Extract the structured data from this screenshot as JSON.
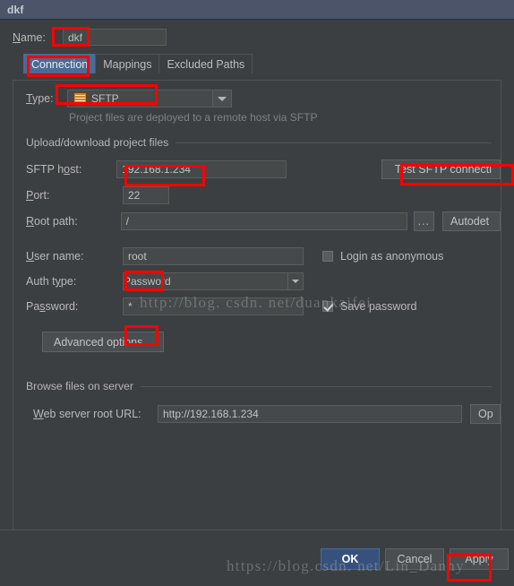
{
  "window": {
    "title": "dkf"
  },
  "name_row": {
    "label": "Name:",
    "value": "dkf"
  },
  "tabs": [
    {
      "label": "Connection",
      "selected": true
    },
    {
      "label": "Mappings",
      "selected": false
    },
    {
      "label": "Excluded Paths",
      "selected": false
    }
  ],
  "type_row": {
    "label": "Type:",
    "value": "SFTP",
    "icon": "ftp-server-icon",
    "hint": "Project files are deployed to a remote host via SFTP"
  },
  "upload_group": {
    "title": "Upload/download project files",
    "sftp_host": {
      "label": "SFTP host:",
      "value": "192.168.1.234"
    },
    "test_button": "Test SFTP connecti",
    "port": {
      "label": "Port:",
      "value": "22"
    },
    "root_path": {
      "label": "Root path:",
      "value": "/"
    },
    "browse_button": "...",
    "autodetect_button": "Autodet",
    "user_name": {
      "label": "User name:",
      "value": "root"
    },
    "login_anonymous": {
      "label": "Login as anonymous",
      "checked": false
    },
    "auth_type": {
      "label": "Auth type:",
      "value": "Password"
    },
    "password": {
      "label": "Password:",
      "value": "*"
    },
    "save_password": {
      "label": "Save password",
      "checked": true
    },
    "advanced_button": "Advanced options..."
  },
  "browse_group": {
    "title": "Browse files on server",
    "web_url": {
      "label": "Web server root URL:",
      "value": "http://192.168.1.234"
    },
    "open_button": "Op"
  },
  "footer": {
    "ok": "OK",
    "cancel": "Cancel",
    "apply": "Apply"
  },
  "watermarks": {
    "one": "http://blog. csdn. net/duankaifei",
    "two": "https://blog.csdn. net/Lin_Danny"
  },
  "colors": {
    "titlebar": "#4b5469",
    "background": "#3c3f41",
    "field": "#45494a",
    "accent": "#4b6a94",
    "primary_button": "#36527c",
    "annotation": "#ff0000"
  }
}
